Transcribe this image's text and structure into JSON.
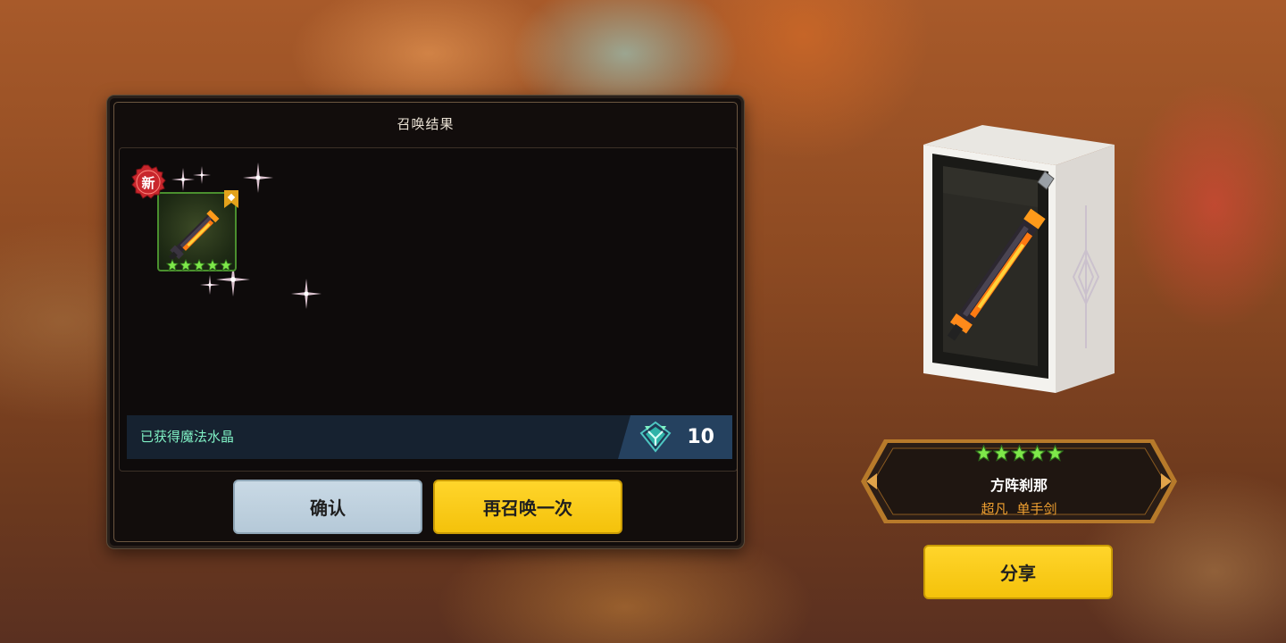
{
  "summon_panel": {
    "title": "召唤结果",
    "result_item": {
      "new_badge": "新",
      "stars": 5,
      "icon": "flame-sword-icon"
    },
    "crystal_bar": {
      "label": "已获得魔法水晶",
      "icon": "magic-crystal-icon",
      "count": "10"
    },
    "buttons": {
      "confirm": "确认",
      "summon_again": "再召唤一次"
    }
  },
  "item_showcase": {
    "stars": 5,
    "name": "方阵刹那",
    "rarity": "超凡",
    "weapon_type": "单手剑",
    "share_button": "分享"
  },
  "colors": {
    "star_green": "#7ee84a",
    "yellow_button": "#f4c20b",
    "confirm_button": "#b5c9d8",
    "crystal_text": "#7ff0c4",
    "rarity_orange": "#f0a030"
  }
}
